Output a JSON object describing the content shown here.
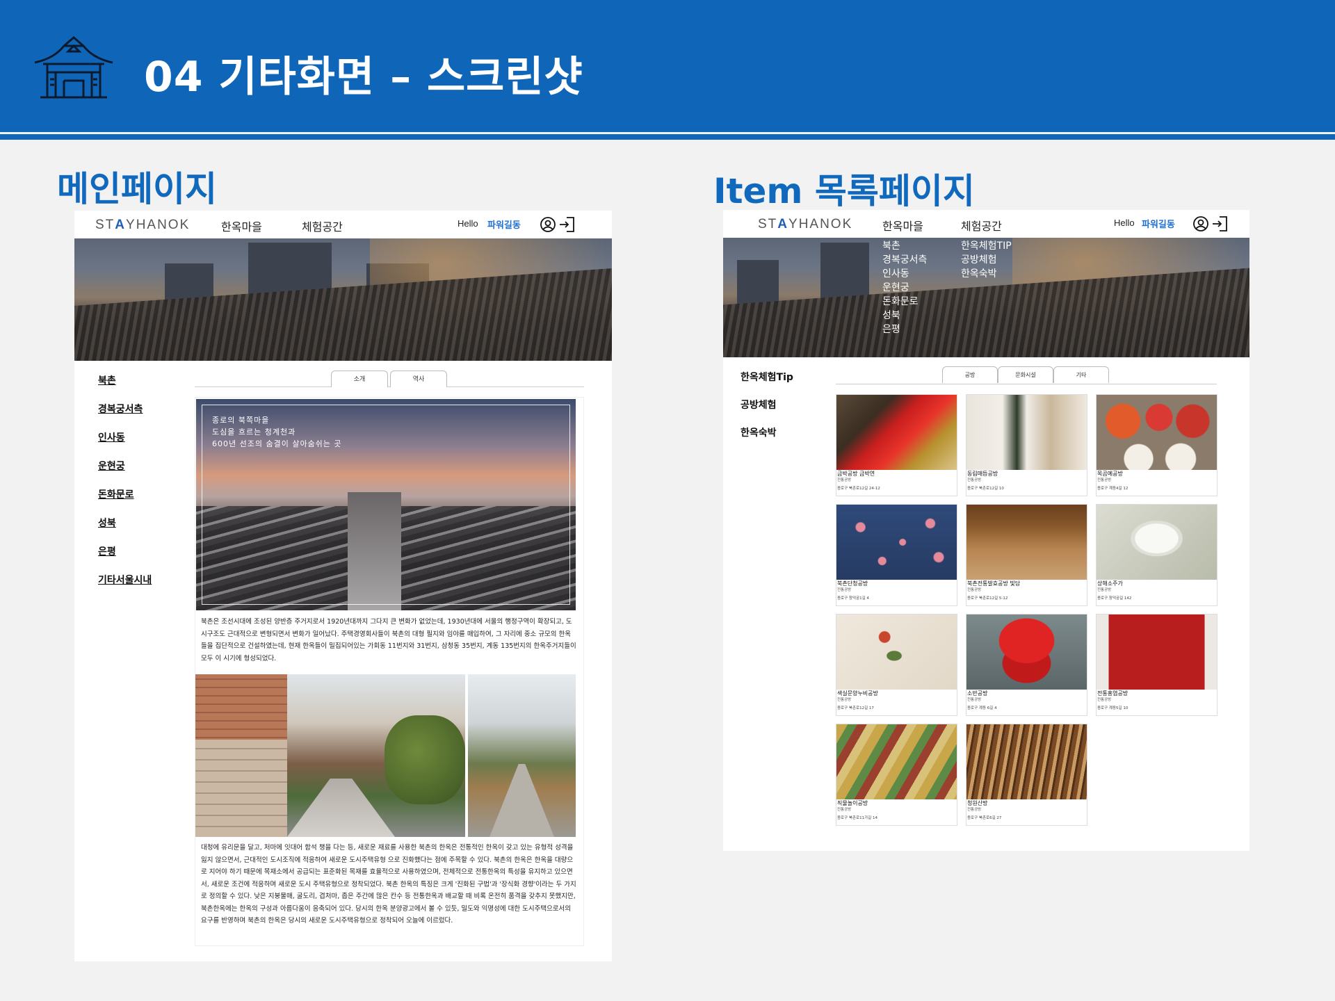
{
  "slide": {
    "title": "04 기타화면 – 스크린샷",
    "section_main": "메인페이지",
    "section_list": "Item 목록페이지",
    "colors": {
      "brand_blue": "#0f66b8",
      "accent_blue": "#1169bd",
      "link_blue": "#1f6fd6"
    }
  },
  "nav": {
    "logo": "STAYHANOK",
    "logo_parts": [
      "ST",
      "A",
      "YHANOK"
    ],
    "menu1": "한옥마을",
    "menu2": "체험공간",
    "hello": "Hello",
    "username": "파워길동",
    "profile_icon": "user-circle-icon",
    "logout_icon": "logout-door-icon"
  },
  "main_page": {
    "sidebar": [
      "북촌",
      "경복궁서측",
      "인사동",
      "운현궁",
      "돈화문로",
      "성북",
      "은평",
      "기타서울시내"
    ],
    "tabs": [
      "소개",
      "역사"
    ],
    "hero_caption": [
      "종로의 북쪽마을",
      "도심을 흐르는 청계천과",
      "600년 선조의 숨결이 살아숨쉬는 곳"
    ],
    "paragraph1": "북촌은 조선시대에 조성된 양반층 주거지로서 1920년대까지 그다지 큰 변화가 없었는데, 1930년대에 서울의 행정구역이 확장되고, 도시구조도 근대적으로 변형되면서 변화가 일어났다. 주택경영회사들이 북촌의 대형 필지와 임야를 매입하여, 그 자리에 중소 규모의 한옥들을 집단적으로 건설하였는데, 현재 한옥들이 밀집되어있는 가회동 11번지와 31번지, 삼청동 35번지, 계동 135번지의 한옥주거지들이 모두 이 시기에 형성되었다.",
    "paragraph2": "대청에 유리문을 달고, 처마에 잇대어 함석 챙을 다는 등, 새로운 재료를 사용한 북촌의 한옥은 전통적인 한옥이 갖고 있는 유형적 성격을 잃지 않으면서, 근대적인 도시조직에 적응하여 새로운 도시주택유형 으로 진화했다는 점에 주목할 수 있다. 북촌의 한옥은 한옥을 대량으로 지어야 하기 때문에 목재소에서 공급되는 표준화된 목재를 효율적으로 사용하였으며, 전체적으로 전통한옥의 특성을 유지하고 있으면서, 새로운 조건에 적응하며 새로운 도시 주택유형으로 정착되었다. 북촌 한옥의 특징은 크게 '진화된 구법'과 '장식화 경향'이라는 두 가지로 정의할 수 있다. 낮은 지붕물매, 굴도리, 겹처마, 좁은 주간에 많은 칸수 등 전통한옥과 배교할 때 비록 온전히 품격을 갖추지 못했지만, 북촌한옥에는 한옥의 구성과 아름다움이 응축되어 있다. 당시의 한옥 분양광고에서 볼 수 있듯, 밀도와 익명성에 대한 도시주택으로서의 요구를 반영하며 북촌의 한옥은 당시의 새로운 도시주택유형으로 정착되어 오늘에 이르렀다."
  },
  "list_page": {
    "dropdown_village": [
      "북촌",
      "경복궁서측",
      "인사동",
      "운현궁",
      "돈화문로",
      "성북",
      "은평"
    ],
    "dropdown_experience": [
      "한옥체험TIP",
      "공방체험",
      "한옥숙박"
    ],
    "sidebar": [
      "한옥체험Tip",
      "공방체험",
      "한옥숙박"
    ],
    "tabs": [
      "공방",
      "문화시설",
      "기타"
    ],
    "items": [
      {
        "name": "금박공방 금박연",
        "category": "전통공방",
        "address": "종로구 북촌로12길 24-12"
      },
      {
        "name": "동림매듭공방",
        "category": "전통공방",
        "address": "종로구 북촌로12길 10"
      },
      {
        "name": "목곰예공방",
        "category": "전통공방",
        "address": "종로구 계동4길 12"
      },
      {
        "name": "북촌단청공방",
        "category": "전통공방",
        "address": "종로구 창덕궁1길 4"
      },
      {
        "name": "북촌전통발효공방 빛담",
        "category": "전통공방",
        "address": "종로구 북촌로12길 5-12"
      },
      {
        "name": "상해소주가",
        "category": "전통공방",
        "address": "종로구 창덕궁길 142"
      },
      {
        "name": "색실문양누비공방",
        "category": "전통공방",
        "address": "종로구 북촌로12길 17"
      },
      {
        "name": "소반공방",
        "category": "전통공방",
        "address": "종로구 계동 6길 4"
      },
      {
        "name": "전통홍염공방",
        "category": "전통공방",
        "address": "종로구 계동5길 10"
      },
      {
        "name": "직물놀이공방",
        "category": "전통공방",
        "address": "종로구 북촌로11가길 14"
      },
      {
        "name": "청원산방",
        "category": "전통공방",
        "address": "종로구 북촌로6길 27"
      }
    ]
  }
}
